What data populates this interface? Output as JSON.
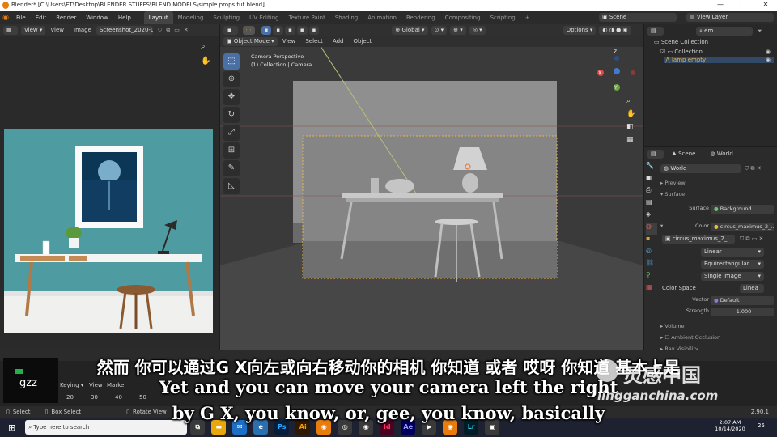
{
  "window": {
    "title": "Blender* [C:\\Users\\ET\\Desktop\\BLENDER STUFFS\\BLEND MODELS\\simple props tut.blend]",
    "minimize": "—",
    "maximize": "☐",
    "close": "✕"
  },
  "menu": [
    "File",
    "Edit",
    "Render",
    "Window",
    "Help"
  ],
  "workspaces": [
    "Layout",
    "Modeling",
    "Sculpting",
    "UV Editing",
    "Texture Paint",
    "Shading",
    "Animation",
    "Rendering",
    "Compositing",
    "Scripting"
  ],
  "scene": {
    "name": "Scene",
    "view_layer": "View Layer"
  },
  "image_editor": {
    "view": "View",
    "menu_view": "View",
    "menu_image": "Image",
    "image_name": "Screenshot_2020-0..."
  },
  "viewport": {
    "mode": "Object Mode",
    "menu": [
      "View",
      "Select",
      "Add",
      "Object"
    ],
    "orientation": "Global",
    "options": "Options",
    "camera_label": "Camera Perspective",
    "collection_label": "(1) Collection | Camera",
    "axis_x": "X",
    "axis_y": "Y",
    "axis_z": "Z"
  },
  "outliner": {
    "search": "em",
    "items": [
      "Scene Collection",
      "Collection",
      "lamp empty"
    ]
  },
  "properties": {
    "scene_tab": "Scene",
    "world_tab": "World",
    "world_name": "World",
    "preview": "Preview",
    "surface_section": "Surface",
    "surface_label": "Surface",
    "surface_value": "Background",
    "color_label": "Color",
    "color_value": "circus_maximus_2_...",
    "image_name": "circus_maximus_2_...",
    "interpolation": "Linear",
    "projection": "Equirectangular",
    "source": "Single Image",
    "color_space_label": "Color Space",
    "color_space_value": "Linea",
    "vector_label": "Vector",
    "vector_value": "Default",
    "strength_label": "Strength",
    "strength_value": "1.000",
    "volume": "Volume",
    "ambient_occlusion": "Ambient Occlusion",
    "ray_visibility": "Ray Visibility",
    "viewport_display": "Viewport Display",
    "custom_properties": "Custom Properties"
  },
  "timeline": {
    "keying": "Keying",
    "view": "View",
    "marker": "Marker",
    "ticks": [
      "20",
      "30",
      "40",
      "50"
    ],
    "overlay_text": "gzz"
  },
  "statusbar": {
    "select": "Select",
    "box_select": "Box Select",
    "rotate_view": "Rotate View",
    "version": "2.90.1"
  },
  "taskbar": {
    "search_placeholder": "Type here to search",
    "time": "2:07 AM",
    "date": "10/14/2020",
    "notifications": "25",
    "apps": [
      "Ps",
      "Ai",
      "Id",
      "Ae",
      "Lr"
    ]
  },
  "subtitles": {
    "chinese": "然而 你可以通过G X向左或向右移动你的相机 你知道 或者 哎呀 你知道 基本上是",
    "english_1": "Yet and you can move your camera left the right",
    "english_2": "by G X, you know, or, gee, you know, basically"
  },
  "watermark": {
    "cn": "灵感中国",
    "url": "lingganchina.com"
  }
}
